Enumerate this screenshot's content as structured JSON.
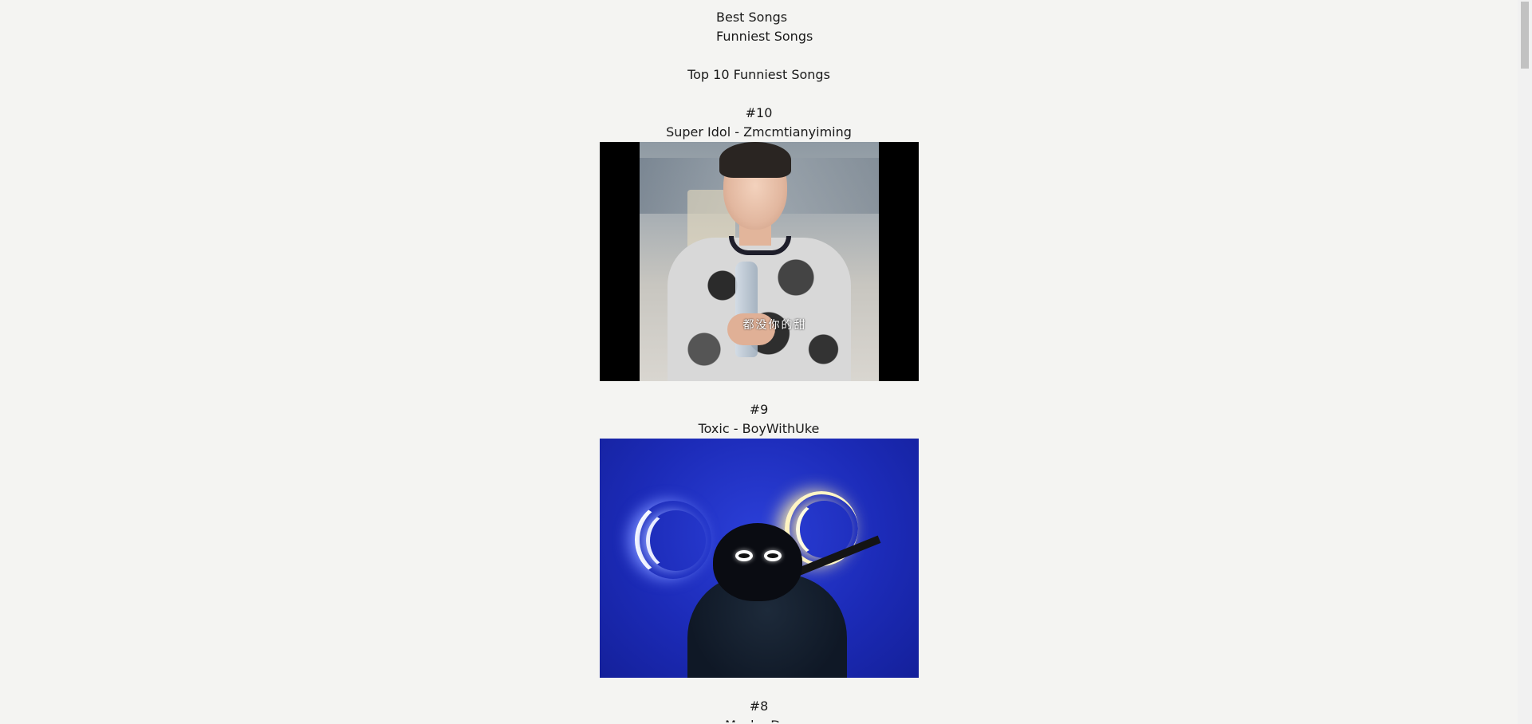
{
  "nav": {
    "items": [
      {
        "label": "Best Songs"
      },
      {
        "label": "Funniest Songs"
      }
    ]
  },
  "page": {
    "title": "Top 10 Funniest Songs"
  },
  "entries": [
    {
      "rank": "#10",
      "title": "Super Idol - Zmcmtianyiming",
      "caption": "都没你的甜"
    },
    {
      "rank": "#9",
      "title": "Toxic - BoyWithUke"
    },
    {
      "rank": "#8",
      "title": "Mask - D..."
    }
  ]
}
